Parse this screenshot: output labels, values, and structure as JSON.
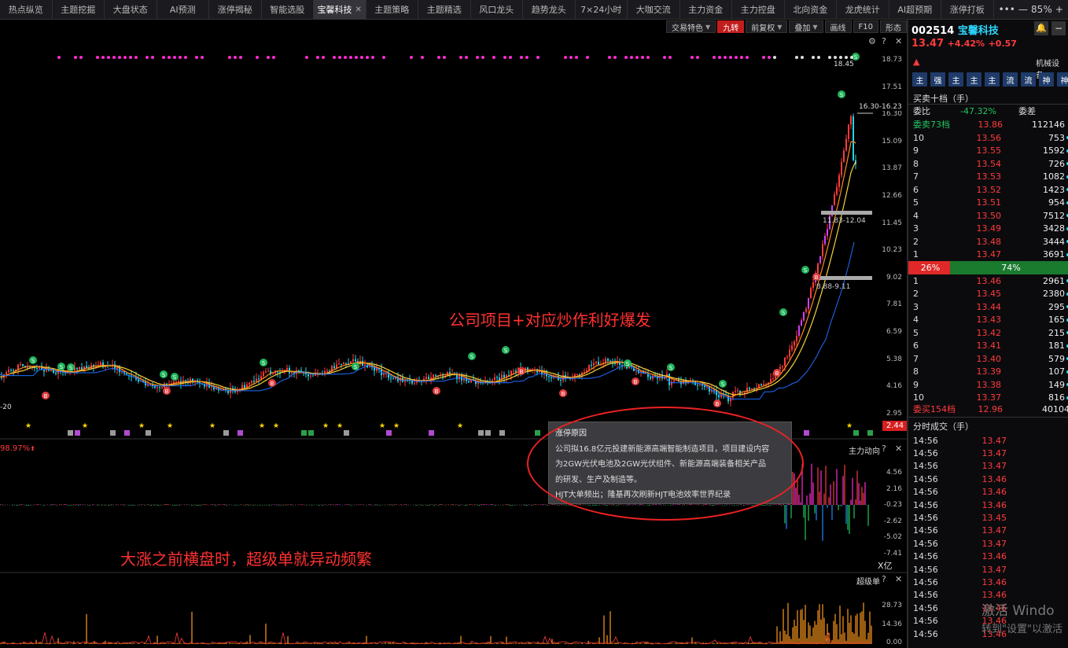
{
  "tabs": [
    "热点纵览",
    "主题挖掘",
    "大盘状态",
    "AI预测",
    "涨停揭秘",
    "智能选股",
    "宝馨科技",
    "主题策略",
    "主题精选",
    "风口龙头",
    "趋势龙头",
    "7×24小时",
    "大咖交流",
    "主力资金",
    "主力控盘",
    "北向资金",
    "龙虎统计",
    "AI超预期",
    "涨停打板"
  ],
  "active_tab": "宝馨科技",
  "tab_tools": {
    "more": "•••",
    "minus": "—",
    "zoom": "85%",
    "plus": "+"
  },
  "toolbar": [
    {
      "label": "交易特色",
      "caret": true
    },
    {
      "label": "九转",
      "active": true
    },
    {
      "label": "前复权",
      "caret": true
    },
    {
      "label": "叠加",
      "caret": true
    },
    {
      "label": "画线"
    },
    {
      "label": "F10"
    },
    {
      "label": "形态"
    }
  ],
  "panel_controls": {
    "gear": "⚙",
    "help": "?",
    "close": "✕"
  },
  "price_axis": [
    "18.73",
    "17.51",
    "16.30",
    "15.09",
    "13.87",
    "12.66",
    "11.45",
    "10.23",
    "9.02",
    "7.81",
    "6.59",
    "5.38",
    "4.16",
    "2.95"
  ],
  "price_annotations": {
    "high": "18.45",
    "high_mark": "16.30-16.23",
    "range1": "11.83-12.04",
    "range2": "8.88-9.11",
    "low_left": "-20",
    "low_price": "2.44"
  },
  "pct_badge": "98.97%",
  "annotations": {
    "main": "公司项目+对应炒作利好爆发",
    "second": "大涨之前横盘时，超级单就异动频繁"
  },
  "tooltip": {
    "title": "涨停原因",
    "lines": [
      "公司拟16.8亿元投建新能源高端智能制造项目，项目建设内容",
      "为2GW光伏电池及2GW光伏组件、新能源高端装备相关产品",
      "的研发、生产及制造等。",
      "HJT大单频出；隆基再次刷新HJT电池效率世界纪录"
    ]
  },
  "panel2": {
    "title": "主力动向",
    "axis": [
      "4.56",
      "2.16",
      "-0.23",
      "-2.62",
      "-5.02",
      "-7.41"
    ],
    "unit": "X亿"
  },
  "panel3": {
    "title": "超级单",
    "axis": [
      "28.73",
      "14.36",
      "0.00"
    ]
  },
  "stock": {
    "code": "002514",
    "name": "宝馨科技",
    "price": "13.47",
    "change_pct": "+4.42%",
    "change": "+0.57",
    "industry": "机械设备..."
  },
  "stock_buttons": [
    "主",
    "强",
    "主",
    "主",
    "主",
    "流",
    "流",
    "神",
    "神"
  ],
  "orderbook": {
    "title": "买卖十档（手）",
    "ratio_label": "委比",
    "ratio": "-47.32%",
    "diff_label": "委差",
    "sell_total_label": "委卖73档",
    "sell_total_price": "13.86",
    "sell_total_vol": "112146",
    "sells": [
      {
        "level": "10",
        "price": "13.56",
        "vol": "753"
      },
      {
        "level": "9",
        "price": "13.55",
        "vol": "1592"
      },
      {
        "level": "8",
        "price": "13.54",
        "vol": "726"
      },
      {
        "level": "7",
        "price": "13.53",
        "vol": "1082"
      },
      {
        "level": "6",
        "price": "13.52",
        "vol": "1423"
      },
      {
        "level": "5",
        "price": "13.51",
        "vol": "954"
      },
      {
        "level": "4",
        "price": "13.50",
        "vol": "7512"
      },
      {
        "level": "3",
        "price": "13.49",
        "vol": "3428"
      },
      {
        "level": "2",
        "price": "13.48",
        "vol": "3444"
      },
      {
        "level": "1",
        "price": "13.47",
        "vol": "3691"
      }
    ],
    "sell_pct": "26%",
    "buy_pct": "74%",
    "sell_frac": 0.26,
    "buys": [
      {
        "level": "1",
        "price": "13.46",
        "vol": "2961"
      },
      {
        "level": "2",
        "price": "13.45",
        "vol": "2380"
      },
      {
        "level": "3",
        "price": "13.44",
        "vol": "295"
      },
      {
        "level": "4",
        "price": "13.43",
        "vol": "165"
      },
      {
        "level": "5",
        "price": "13.42",
        "vol": "215"
      },
      {
        "level": "6",
        "price": "13.41",
        "vol": "181"
      },
      {
        "level": "7",
        "price": "13.40",
        "vol": "579"
      },
      {
        "level": "8",
        "price": "13.39",
        "vol": "107"
      },
      {
        "level": "9",
        "price": "13.38",
        "vol": "149"
      },
      {
        "level": "10",
        "price": "13.37",
        "vol": "816"
      }
    ],
    "buy_total_label": "委买154档",
    "buy_total_price": "12.96",
    "buy_total_vol": "40104"
  },
  "ticks": {
    "title": "分时成交（手）",
    "rows": [
      {
        "time": "14:56",
        "price": "13.47"
      },
      {
        "time": "14:56",
        "price": "13.47"
      },
      {
        "time": "14:56",
        "price": "13.47"
      },
      {
        "time": "14:56",
        "price": "13.46"
      },
      {
        "time": "14:56",
        "price": "13.46"
      },
      {
        "time": "14:56",
        "price": "13.46"
      },
      {
        "time": "14:56",
        "price": "13.45"
      },
      {
        "time": "14:56",
        "price": "13.47"
      },
      {
        "time": "14:56",
        "price": "13.47"
      },
      {
        "time": "14:56",
        "price": "13.46"
      },
      {
        "time": "14:56",
        "price": "13.47"
      },
      {
        "time": "14:56",
        "price": "13.46"
      },
      {
        "time": "14:56",
        "price": "13.46"
      },
      {
        "time": "14:56",
        "price": "13.46"
      },
      {
        "time": "14:56",
        "price": "13.46"
      },
      {
        "time": "14:56",
        "price": "13.46"
      }
    ]
  },
  "watermark": {
    "line1": "激活 Windo",
    "line2": "转到\"设置\"以激活"
  },
  "colors": {
    "up": "#ff3b3b",
    "down": "#22d3e6",
    "ma_yellow": "#f5d33a",
    "ma_orange": "#ff8a1a",
    "support": "#1e6fff",
    "purple": "#d040ff",
    "magenta": "#ff2bd4",
    "green": "#22c55e"
  }
}
